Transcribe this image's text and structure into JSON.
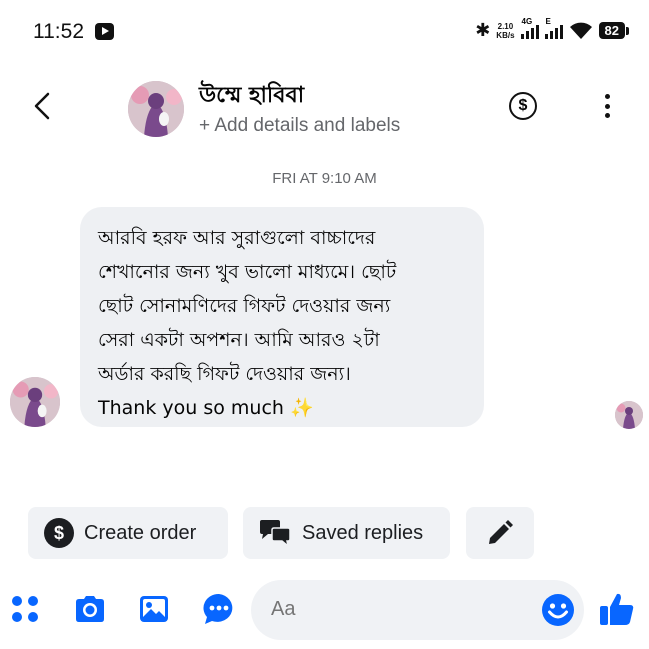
{
  "status_bar": {
    "time": "11:52",
    "speed_value": "2.10",
    "speed_unit": "KB/s",
    "network_1": "4G",
    "network_2": "E",
    "battery": "82"
  },
  "header": {
    "contact_name": "উম্মে হাবিবা",
    "add_details": "+ Add details and labels"
  },
  "conversation": {
    "timestamp": "FRI AT 9:10 AM",
    "message": "আরবি হরফ আর সুরাগুলো বাচ্চাদের\nশেখানোর জন্য খুব ভালো মাধ্যমে। ছোট\nছোট সোনামণিদের গিফট দেওয়ার জন্য\nসেরা একটা অপশন। আমি আরও ২টা\nঅর্ডার করছি গিফট দেওয়ার জন্য।\nThank you so much ✨"
  },
  "quick_actions": {
    "create_order": "Create order",
    "saved_replies": "Saved replies"
  },
  "composer": {
    "placeholder": "Aa"
  },
  "colors": {
    "accent": "#0866ff",
    "bubble": "#eef0f3",
    "secondary_text": "#65676b"
  }
}
